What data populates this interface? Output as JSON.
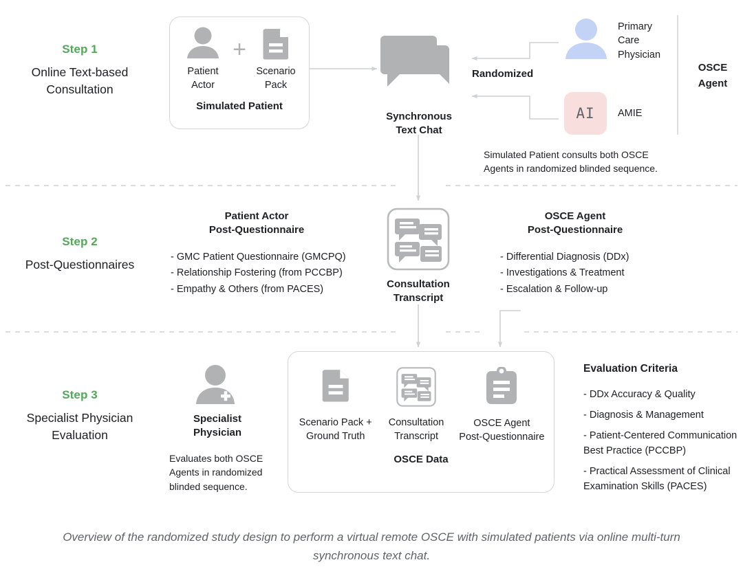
{
  "steps": [
    {
      "label": "Step 1",
      "title": "Online Text-based\nConsultation"
    },
    {
      "label": "Step 2",
      "title": "Post-Questionnaires"
    },
    {
      "label": "Step 3",
      "title": "Specialist Physician\nEvaluation"
    }
  ],
  "step1": {
    "simulated_patient_box": {
      "patient_actor_label": "Patient\nActor",
      "plus": "+",
      "scenario_pack_label": "Scenario\nPack",
      "box_caption": "Simulated Patient"
    },
    "chat": {
      "caption": "Synchronous\nText Chat"
    },
    "randomized_label": "Randomized",
    "agents": [
      {
        "name": "Primary\nCare\nPhysician",
        "icon": "person-icon",
        "color": "#c2d3f6"
      },
      {
        "name": "AMIE",
        "icon": "ai-badge",
        "badge_text": "AI",
        "color": "#f8dedc"
      }
    ],
    "osce_agent_side_label": "OSCE\nAgent",
    "note": "Simulated Patient consults both OSCE\nAgents in randomized blinded sequence."
  },
  "step2": {
    "left_panel": {
      "title": "Patient Actor\nPost-Questionnaire",
      "items": [
        "- GMC Patient Questionnaire (GMCPQ)",
        "- Relationship Fostering (from PCCBP)",
        "- Empathy & Others (from PACES)"
      ]
    },
    "transcript": {
      "caption": "Consultation\nTranscript"
    },
    "right_panel": {
      "title": "OSCE Agent\nPost-Questionnaire",
      "items": [
        "- Differential Diagnosis (DDx)",
        "- Investigations & Treatment",
        "- Escalation & Follow-up"
      ]
    }
  },
  "step3": {
    "physician": {
      "caption": "Specialist\nPhysician",
      "note": "Evaluates both OSCE\nAgents in randomized\nblinded sequence."
    },
    "osce_data_box": {
      "items": [
        {
          "icon": "document-icon",
          "label": "Scenario Pack +\nGround Truth"
        },
        {
          "icon": "transcript-icon",
          "label": "Consultation\nTranscript"
        },
        {
          "icon": "clipboard-icon",
          "label": "OSCE Agent\nPost-Questionnaire"
        }
      ],
      "box_caption": "OSCE Data"
    },
    "evaluation_criteria": {
      "title": "Evaluation Criteria",
      "items": [
        "- DDx Accuracy & Quality",
        "- Diagnosis & Management",
        "- Patient-Centered Communication\n  Best Practice (PCCBP)",
        "- Practical Assessment of Clinical\n  Examination Skills (PACES)"
      ]
    }
  },
  "caption": "Overview of the randomized study design to perform a virtual remote OSCE with simulated patients via online multi-turn synchronous text chat.",
  "colors": {
    "accent_green": "#53a85a",
    "icon_gray": "#b0b2b3",
    "pcp_blue": "#c2d3f6",
    "ai_pink": "#f8dedc",
    "line_gray": "#d4d6d8",
    "caption_gray": "#5f6368"
  }
}
